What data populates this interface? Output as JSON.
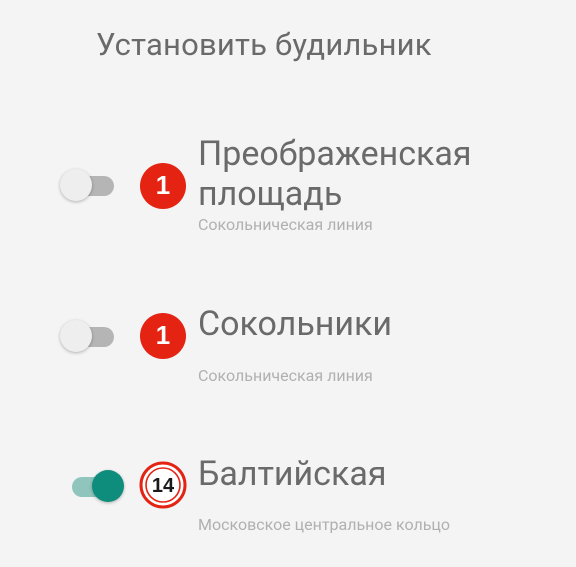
{
  "screen": {
    "title": "Установить будильник"
  },
  "stations": [
    {
      "name": "Преображенская площадь",
      "line": "Сокольническая линия",
      "badge": "1",
      "badge_style": "filled",
      "line_color": "#e42313",
      "alarm_on": false
    },
    {
      "name": "Сокольники",
      "line": "Сокольническая линия",
      "badge": "1",
      "badge_style": "filled",
      "line_color": "#e42313",
      "alarm_on": false
    },
    {
      "name": "Балтийская",
      "line": "Московское центральное кольцо",
      "badge": "14",
      "badge_style": "ring",
      "line_color": "#e42313",
      "alarm_on": true
    }
  ],
  "colors": {
    "accent": "#0e8c7c",
    "accent_track": "#8fc5bd",
    "metro_red": "#e42313"
  },
  "icons": {
    "line1": "metro-line-1-icon",
    "line14": "mcc-line-14-icon"
  }
}
